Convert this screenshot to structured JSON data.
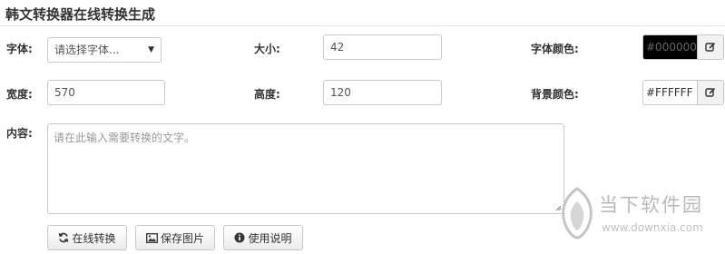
{
  "page": {
    "title": "韩文转换器在线转换生成"
  },
  "form": {
    "font_label": "字体:",
    "font_select_value": "请选择字体...",
    "size_label": "大小:",
    "size_value": "42",
    "font_color_label": "字体颜色:",
    "font_color_value": "#000000",
    "width_label": "宽度:",
    "width_value": "570",
    "height_label": "高度:",
    "height_value": "120",
    "bg_color_label": "背景颜色:",
    "bg_color_value": "#FFFFFF",
    "content_label": "内容:",
    "content_placeholder": "请在此输入需要转换的文字。"
  },
  "actions": {
    "convert_label": "在线转换",
    "save_label": "保存图片",
    "help_label": "使用说明"
  },
  "icons": {
    "convert": "refresh-icon",
    "save": "image-icon",
    "help": "info-icon",
    "color_edit": "edit-icon"
  },
  "colors": {
    "font_color_swatch": "#000000",
    "bg_color_swatch": "#FFFFFF",
    "watermark": "#b9b9b9"
  },
  "watermark": {
    "name": "当下软件园",
    "url": "www.downxia.com"
  }
}
